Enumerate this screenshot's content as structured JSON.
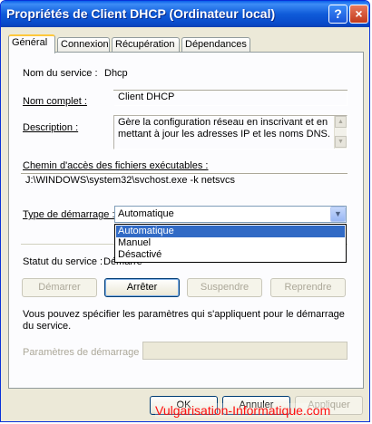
{
  "window": {
    "title": "Propriétés de Client DHCP (Ordinateur local)",
    "help_label": "?",
    "close_label": "×"
  },
  "tabs": [
    {
      "label": "Général"
    },
    {
      "label": "Connexion"
    },
    {
      "label": "Récupération"
    },
    {
      "label": "Dépendances"
    }
  ],
  "general": {
    "service_name_label": "Nom du service :",
    "service_name_value": "Dhcp",
    "display_name_label": "Nom complet :",
    "display_name_value": "Client DHCP",
    "description_label": "Description :",
    "description_value": "Gère la configuration réseau en inscrivant et en mettant à jour les adresses IP et les noms DNS.",
    "path_label": "Chemin d'accès des fichiers exécutables :",
    "path_value": "J:\\WINDOWS\\system32\\svchost.exe -k netsvcs",
    "startup_type_label": "Type de démarrage :",
    "startup_type_value": "Automatique",
    "startup_options": [
      "Automatique",
      "Manuel",
      "Désactivé"
    ],
    "status_label": "Statut du service :",
    "status_value": "Démarré",
    "buttons": {
      "start": "Démarrer",
      "stop": "Arrêter",
      "pause": "Suspendre",
      "resume": "Reprendre"
    },
    "params_note": "Vous pouvez spécifier les paramètres qui s'appliquent pour le démarrage du service.",
    "params_label": "Paramètres de démarrage :",
    "params_value": ""
  },
  "footer": {
    "ok": "OK",
    "cancel": "Annuler",
    "apply": "Appliquer"
  },
  "watermark": "Vulgarisation-Informatique.com",
  "colors": {
    "titlebar": "#0a5fea",
    "selection": "#316ac5",
    "watermark": "#ff1010"
  }
}
